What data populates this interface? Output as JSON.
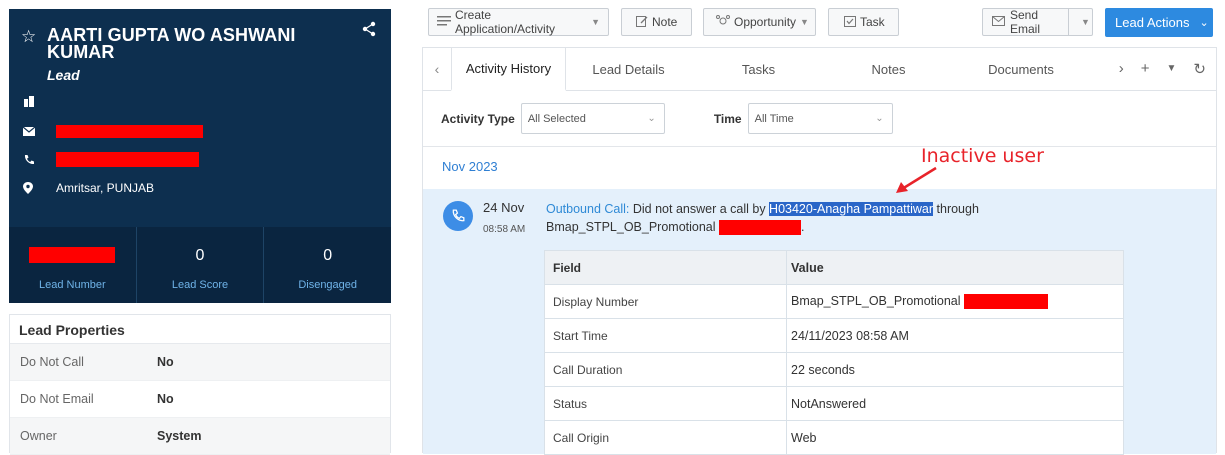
{
  "lead": {
    "name": "AARTI GUPTA WO ASHWANI KUMAR",
    "type": "Lead",
    "location": "Amritsar, PUNJAB",
    "stats": [
      {
        "value": "",
        "label": "Lead Number"
      },
      {
        "value": "0",
        "label": "Lead Score"
      },
      {
        "value": "0",
        "label": "Disengaged"
      }
    ]
  },
  "properties": {
    "title": "Lead Properties",
    "rows": [
      {
        "key": "Do Not Call",
        "value": "No"
      },
      {
        "key": "Do Not Email",
        "value": "No"
      },
      {
        "key": "Owner",
        "value": "System"
      }
    ]
  },
  "toolbar": {
    "create_label": "Create Application/Activity",
    "note_label": "Note",
    "opportunity_label": "Opportunity",
    "task_label": "Task",
    "send_email_label": "Send Email",
    "lead_actions_label": "Lead Actions"
  },
  "tabs": [
    "Activity History",
    "Lead Details",
    "Tasks",
    "Notes",
    "Documents"
  ],
  "filters": {
    "activity_type_label": "Activity Type",
    "activity_type_value": "All Selected",
    "time_label": "Time",
    "time_value": "All Time"
  },
  "month": "Nov 2023",
  "activity": {
    "date": "24 Nov",
    "time": "08:58 AM",
    "type_label": "Outbound Call:",
    "text_before": " Did not answer a call by ",
    "highlight_user": "H03420-Anagha Pampattiwar",
    "text_after": " through",
    "line2": "Bmap_STPL_OB_Promotional",
    "table_header": [
      "Field",
      "Value"
    ],
    "table_rows": [
      {
        "field": "Display Number",
        "value": "Bmap_STPL_OB_Promotional"
      },
      {
        "field": "Start Time",
        "value": "24/11/2023 08:58 AM"
      },
      {
        "field": "Call Duration",
        "value": "22 seconds"
      },
      {
        "field": "Status",
        "value": "NotAnswered"
      },
      {
        "field": "Call Origin",
        "value": "Web"
      }
    ]
  },
  "annotation": "Inactive user",
  "colors": {
    "card_bg": "#0d2f4f",
    "accent_blue": "#2d8ae0",
    "redaction": "#ff0000",
    "annotation": "#e8232a"
  }
}
